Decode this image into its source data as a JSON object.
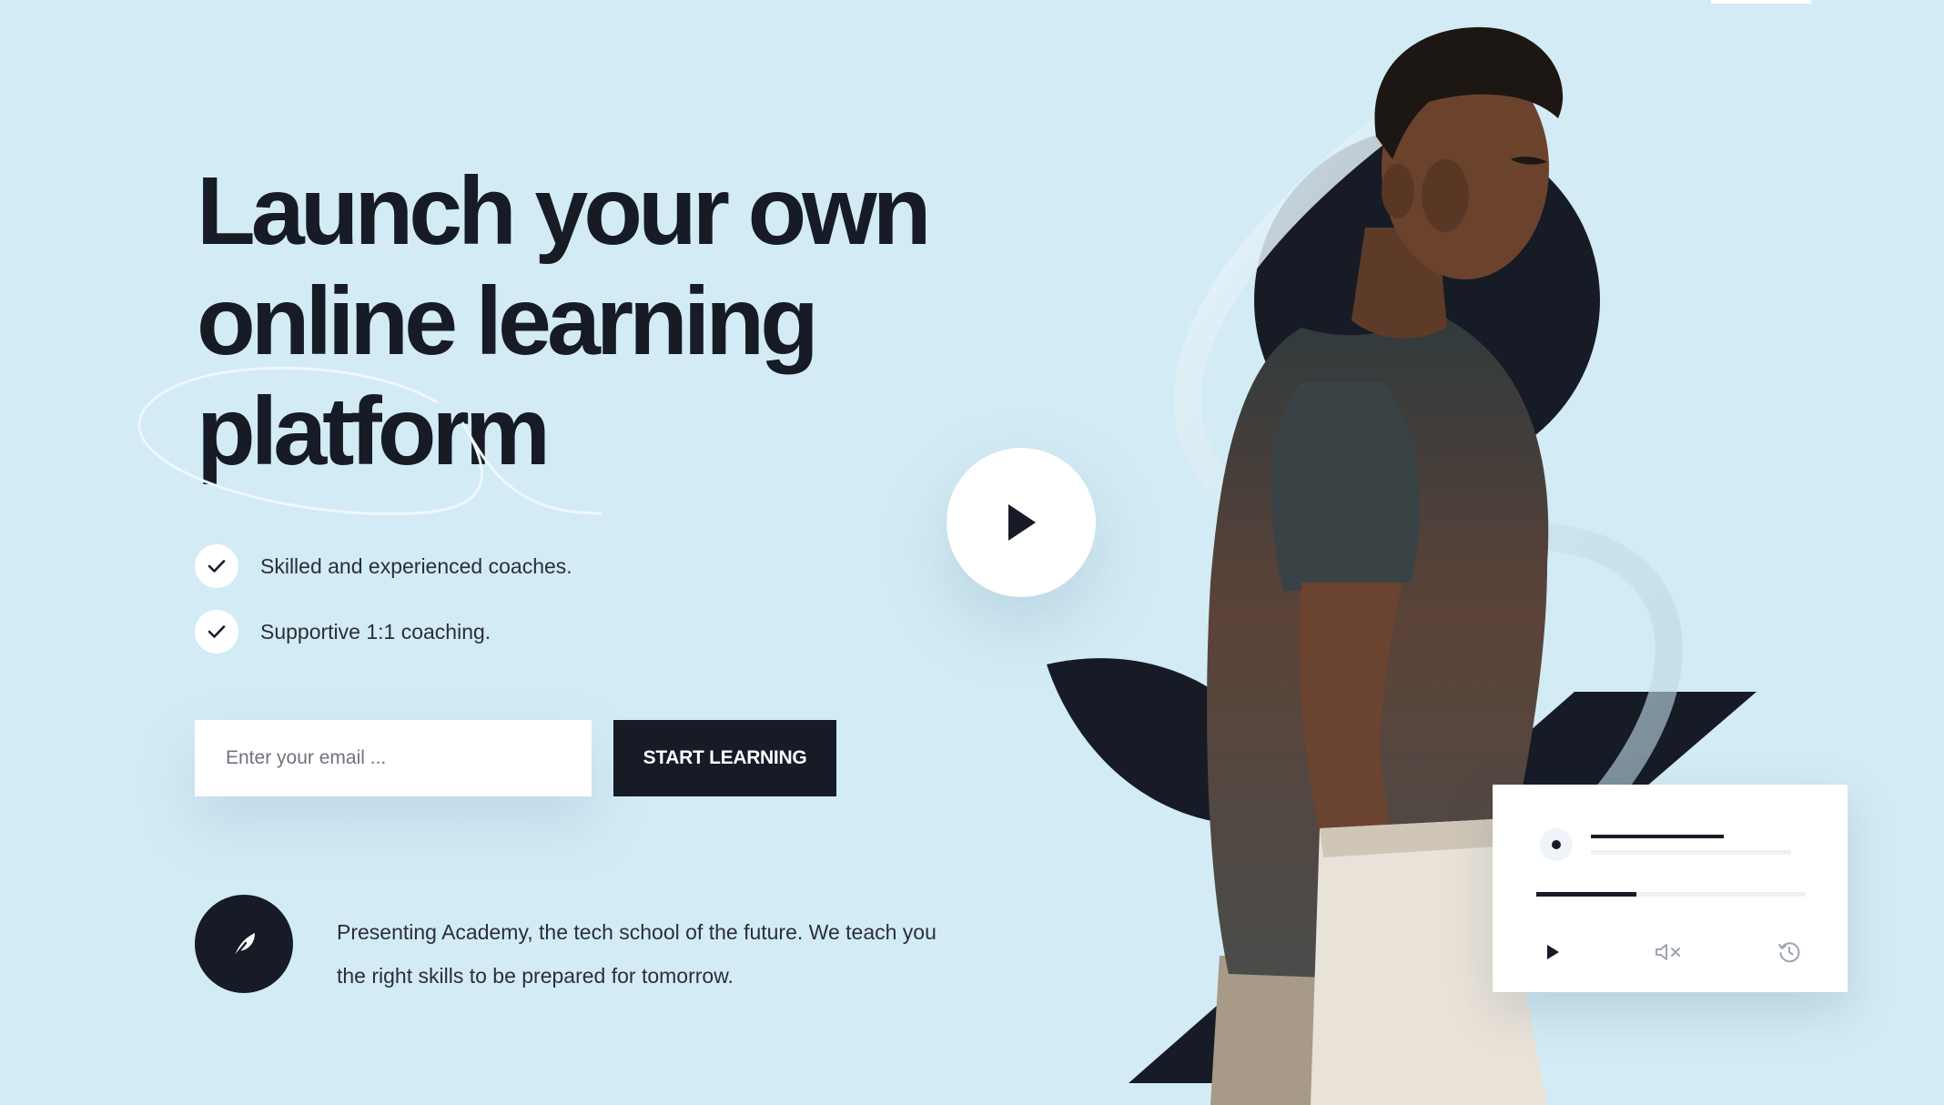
{
  "hero": {
    "title_lines": [
      "Launch your own",
      "online learning",
      "platform"
    ]
  },
  "features": [
    {
      "icon": "check-icon",
      "text": "Skilled and experienced coaches."
    },
    {
      "icon": "check-icon",
      "text": "Supportive 1:1 coaching."
    }
  ],
  "signup": {
    "email_placeholder": "Enter your email ...",
    "email_value": "",
    "button_label": "START LEARNING"
  },
  "about": {
    "icon": "feather-icon",
    "text": "Presenting Academy, the tech school of the future. We teach you the right skills to be prepared for tomorrow."
  },
  "video": {
    "play_icon": "play-icon"
  },
  "player": {
    "progress": 0.37,
    "controls": [
      "play-icon",
      "mute-icon",
      "history-icon"
    ]
  },
  "colors": {
    "background": "#d3ebf5",
    "dark": "#161b26",
    "white": "#ffffff"
  }
}
